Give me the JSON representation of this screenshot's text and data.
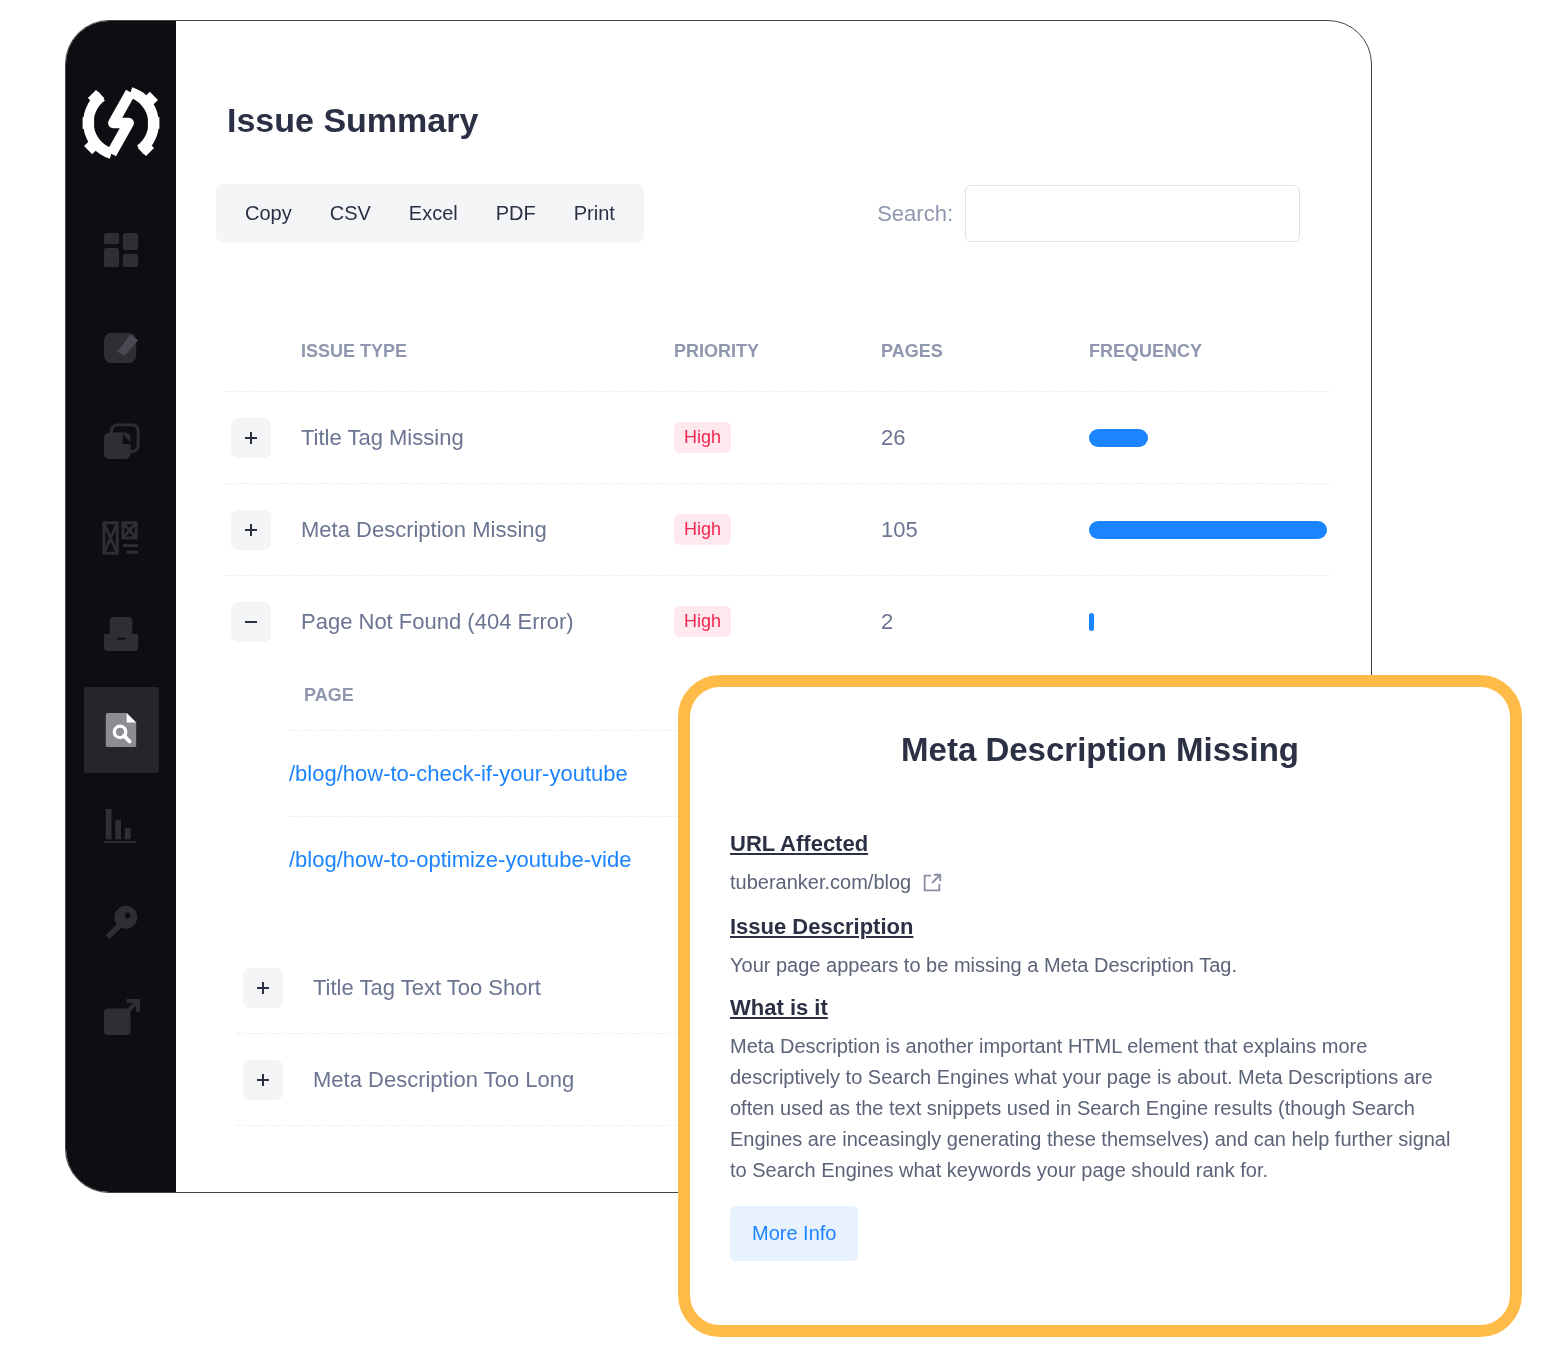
{
  "sidebar": {
    "items": [
      {
        "selected": false
      },
      {
        "selected": false
      },
      {
        "selected": false
      },
      {
        "selected": false
      },
      {
        "selected": false
      },
      {
        "selected": true
      },
      {
        "selected": false
      },
      {
        "selected": false
      },
      {
        "selected": false
      }
    ]
  },
  "title": "Issue Summary",
  "export_buttons": [
    "Copy",
    "CSV",
    "Excel",
    "PDF",
    "Print"
  ],
  "search": {
    "label": "Search:"
  },
  "table": {
    "columns": [
      "ISSUE TYPE",
      "PRIORITY",
      "PAGES",
      "FREQUENCY"
    ],
    "rows": [
      {
        "issue": "Title Tag Missing",
        "expanded": false,
        "priority": "High",
        "pages": "26"
      },
      {
        "issue": "Meta Description Missing",
        "expanded": false,
        "priority": "High",
        "pages": "105"
      },
      {
        "issue": "Page Not Found (404 Error)",
        "expanded": true,
        "priority": "High",
        "pages": "2",
        "details": {
          "column": "PAGE",
          "links": [
            "/blog/how-to-check-if-your-youtube",
            "/blog/how-to-optimize-youtube-vide"
          ]
        }
      },
      {
        "issue": "Title Tag Text Too Short",
        "expanded": false
      },
      {
        "issue": "Meta Description Too Long",
        "expanded": false
      }
    ]
  },
  "popup": {
    "title": "Meta Description Missing",
    "sections": [
      {
        "heading": "URL Affected",
        "kind": "link",
        "text": "tuberanker.com/blog"
      },
      {
        "heading": "Issue Description",
        "kind": "text",
        "text": "Your page appears to be missing a Meta Description Tag."
      },
      {
        "heading": "What is it",
        "kind": "text",
        "text": "Meta Description is another important HTML element that explains more descriptively to Search Engines what your page is about. Meta Descriptions are often used as the text snippets used in Search Engine results (though Search Engines are inceasingly generating these themselves) and can help further signal to Search Engines what keywords your page should rank for."
      }
    ],
    "button": "More Info"
  }
}
